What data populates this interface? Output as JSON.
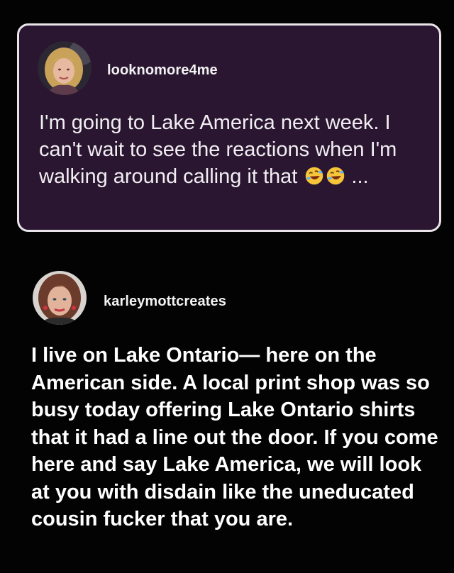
{
  "post": {
    "username": "looknomore4me",
    "text": "I'm going to Lake America next week. I can't wait to see the reactions when I'm walking around calling it that",
    "emojis": [
      "rolling-on-floor-laughing-icon",
      "rolling-on-floor-laughing-icon"
    ],
    "ellipsis": "..."
  },
  "reply": {
    "username": "karleymottcreates",
    "text": "I live on Lake Ontario— here on the American side. A local print shop was so busy today offering Lake Ontario shirts that it had a line out the door. If you come here and say Lake America, we will look at you with disdain like the uneducated cousin fucker that you are."
  },
  "colors": {
    "background": "#030303",
    "card_background": "#2a1630",
    "card_border": "#e8e4ea",
    "text": "#ffffff"
  }
}
